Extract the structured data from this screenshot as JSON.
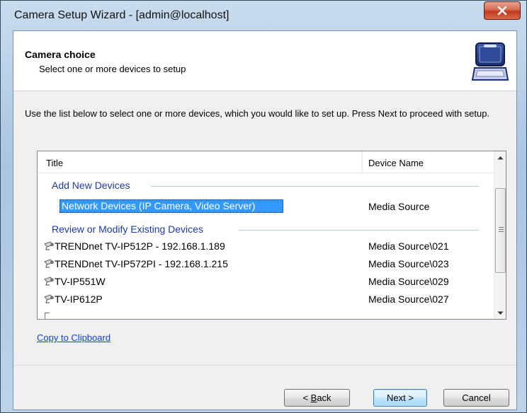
{
  "window": {
    "title": "Camera Setup Wizard - [admin@localhost]",
    "close_label": "X"
  },
  "header": {
    "title": "Camera choice",
    "subtitle": "Select one or more devices to setup",
    "icon": "laptop-icon"
  },
  "instructions": "Use the list below to select one or more devices, which you would like to set up. Press Next to proceed with setup.",
  "list": {
    "columns": [
      "Title",
      "Device Name"
    ],
    "groups": [
      {
        "label": "Add New Devices",
        "rows": [
          {
            "title": "Network Devices (IP Camera, Video Server)",
            "device": "Media Source",
            "selected": true,
            "icon": ""
          }
        ]
      },
      {
        "label": "Review or Modify Existing Devices",
        "rows": [
          {
            "title": "TRENDnet TV-IP512P - 192.168.1.189",
            "device": "Media Source\\021",
            "icon": "camera-icon"
          },
          {
            "title": "TRENDnet TV-IP572PI - 192.168.1.215",
            "device": "Media Source\\023",
            "icon": "camera-icon"
          },
          {
            "title": "TV-IP551W",
            "device": "Media Source\\029",
            "icon": "camera-icon"
          },
          {
            "title": "TV-IP612P",
            "device": "Media Source\\027",
            "icon": "camera-icon"
          }
        ]
      }
    ]
  },
  "copy_link": "Copy to Clipboard",
  "buttons": {
    "back_prefix": "< ",
    "back_mnemonic": "B",
    "back_rest": "ack",
    "next": "Next >",
    "cancel": "Cancel"
  },
  "colors": {
    "selection": "#3399ff",
    "group_header": "#1e3aa0",
    "link": "#0b3fcf",
    "close_button": "#c0391f"
  }
}
